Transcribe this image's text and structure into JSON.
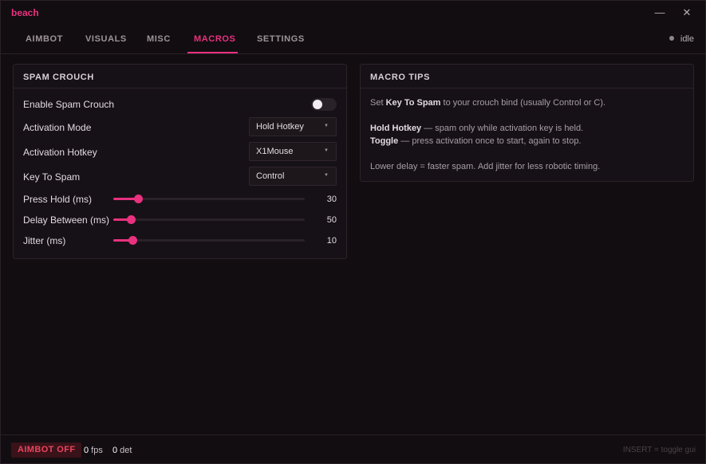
{
  "app": {
    "title": "beach",
    "minimize_icon": "minimize-icon",
    "close_icon": "close-icon"
  },
  "tabs": [
    {
      "label": "AIMBOT"
    },
    {
      "label": "VISUALS"
    },
    {
      "label": "MISC"
    },
    {
      "label": "MACROS",
      "active": true
    },
    {
      "label": "SETTINGS"
    }
  ],
  "status": {
    "label": "idle"
  },
  "spam_crouch": {
    "title": "SPAM CROUCH",
    "enable": {
      "label": "Enable Spam Crouch",
      "on": false
    },
    "activation_mode": {
      "label": "Activation Mode",
      "value": "Hold Hotkey"
    },
    "activation_hotkey": {
      "label": "Activation Hotkey",
      "value": "X1Mouse"
    },
    "key_to_spam": {
      "label": "Key To Spam",
      "value": "Control"
    },
    "press_hold": {
      "label": "Press Hold (ms)",
      "value": "30",
      "level": 0.13
    },
    "delay_between": {
      "label": "Delay Between (ms)",
      "value": "50",
      "level": 0.09
    },
    "jitter": {
      "label": "Jitter (ms)",
      "value": "10",
      "level": 0.1
    }
  },
  "tips": {
    "title": "MACRO TIPS",
    "line1_pre": "Set ",
    "line1_bold": "Key To Spam",
    "line1_post": " to your crouch bind (usually Control or C).",
    "line2_bold": "Hold Hotkey",
    "line2_post": " — spam only while activation key is held.",
    "line3_bold": "Toggle",
    "line3_post": " — press activation once to start, again to stop.",
    "line4": "Lower delay = faster spam. Add jitter for less robotic timing."
  },
  "footer": {
    "aimbot": "AIMBOT OFF",
    "fps_value": "0",
    "fps_unit": " fps",
    "det_value": "0",
    "det_unit": " det",
    "hint": "INSERT = toggle gui"
  },
  "colors": {
    "accent": "#e8317f",
    "background": "#120d11",
    "danger": "#e8455e"
  }
}
